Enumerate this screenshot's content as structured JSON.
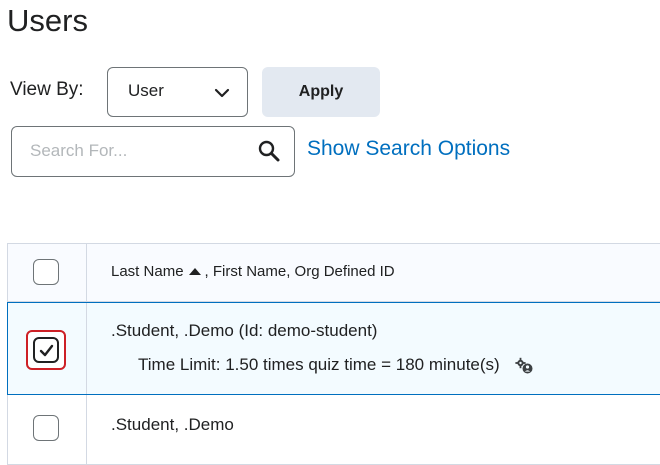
{
  "page": {
    "title": "Users"
  },
  "view_by": {
    "label": "View By:",
    "selected": "User",
    "apply_label": "Apply"
  },
  "search": {
    "placeholder": "Search For...",
    "options_link": "Show Search Options"
  },
  "table": {
    "header": {
      "last_name": "Last Name",
      "rest": ", First Name, Org Defined ID"
    },
    "rows": [
      {
        "name": ".Student, .Demo (Id: demo-student)",
        "detail": "Time Limit: 1.50 times quiz time = 180 minute(s)",
        "checked": true
      },
      {
        "name": ".Student, .Demo",
        "checked": false
      }
    ]
  },
  "colors": {
    "link": "#006fbf",
    "selected_border": "#006fbf",
    "focus_ring": "#cd2026",
    "apply_bg": "#e3e9f1"
  },
  "icons": {
    "select": "chevron-down-icon",
    "search": "search-icon",
    "sort": "sort-ascending-icon",
    "special_access": "gear-user-icon"
  }
}
